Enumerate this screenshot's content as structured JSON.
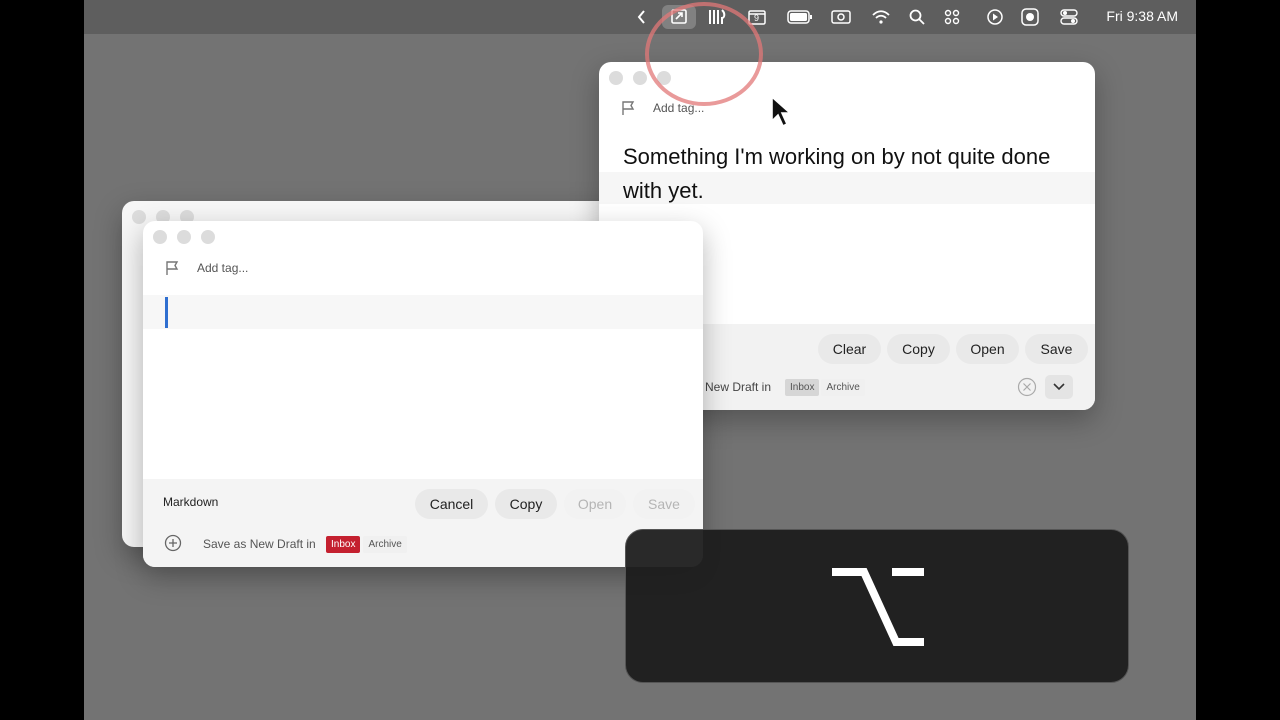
{
  "menubar": {
    "clock": "Fri 9:38 AM",
    "calendar_day": "9",
    "icons": [
      "chevron-left-icon",
      "screen-mirror-icon",
      "utensils-icon",
      "calendar-icon",
      "battery-icon",
      "camera-icon",
      "wifi-icon",
      "search-icon",
      "grid-icon",
      "play-icon",
      "record-icon",
      "control-center-icon"
    ]
  },
  "right_window": {
    "tag_placeholder": "Add tag...",
    "body_text": "Something I'm working on by not quite done with yet.",
    "buttons": {
      "clear": "Clear",
      "copy": "Copy",
      "open": "Open",
      "save": "Save"
    },
    "save_text": "New Draft in",
    "destinations": [
      "Inbox",
      "Archive"
    ],
    "selected_destination": "Inbox"
  },
  "front_window": {
    "tag_placeholder": "Add tag...",
    "syntax": "Markdown",
    "buttons": {
      "cancel": "Cancel",
      "copy": "Copy",
      "open": "Open",
      "save": "Save"
    },
    "save_text": "Save as New Draft in",
    "destinations": [
      "Inbox",
      "Archive"
    ],
    "selected_destination": "Inbox",
    "accent": "#c4202f"
  },
  "hud": {
    "key_icon": "option-key-icon"
  }
}
